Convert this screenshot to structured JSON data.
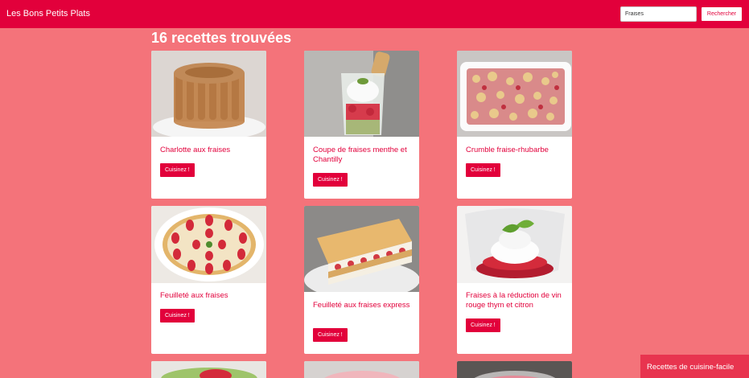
{
  "navbar": {
    "brand": "Les Bons Petits Plats",
    "search_value": "Fraises",
    "search_button": "Rechercher"
  },
  "results_title": "16 recettes trouvées",
  "recipes": [
    {
      "title": "Charlotte aux fraises",
      "button": "Cuisinez !"
    },
    {
      "title": "Coupe de fraises menthe et Chantilly",
      "button": "Cuisinez !"
    },
    {
      "title": "Crumble fraise-rhubarbe",
      "button": "Cuisinez !"
    },
    {
      "title": "Feuilleté aux fraises",
      "button": "Cuisinez !"
    },
    {
      "title": "Feuilleté aux fraises express",
      "button": "Cuisinez !"
    },
    {
      "title": "Fraises à la réduction de vin rouge thym et citron",
      "button": "Cuisinez !"
    }
  ],
  "footer_tab": "Recettes de cuisine-facile"
}
